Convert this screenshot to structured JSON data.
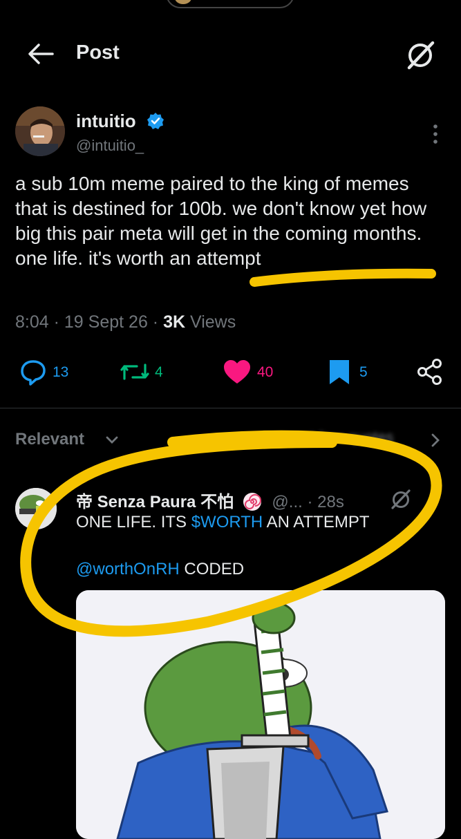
{
  "header": {
    "title": "Post"
  },
  "post": {
    "author_name": "intuitio",
    "handle": "@intuitio_",
    "text": "a sub 10m meme paired to the king of memes that is destined for 100b. we don't know yet how big this pair meta will get in the coming months. one life. it's worth an attempt",
    "time": "8:04",
    "date": "19 Sept 26",
    "views_count": "3K",
    "views_label": "Views",
    "replies": "13",
    "reposts": "4",
    "likes": "40",
    "bookmarks": "5"
  },
  "replies_section": {
    "sort_label": "Relevant",
    "blurred_label": "View quotes"
  },
  "reply": {
    "name": "帝 Senza Paura 不怕",
    "handle": "@...",
    "time": "· 28s",
    "line1_pre": "ONE LIFE. ITS ",
    "line1_cashtag": "$WORTH",
    "line1_post": " AN ATTEMPT",
    "mention": "@worthOnRH",
    "line2_post": " CODED"
  },
  "colors": {
    "background": "#000000",
    "text": "#e7e9ea",
    "secondary": "#71767b",
    "accent_blue": "#1d9bf0",
    "repost_green": "#00ba7c",
    "like_pink": "#f91880",
    "highlight_yellow": "#f6c400"
  }
}
